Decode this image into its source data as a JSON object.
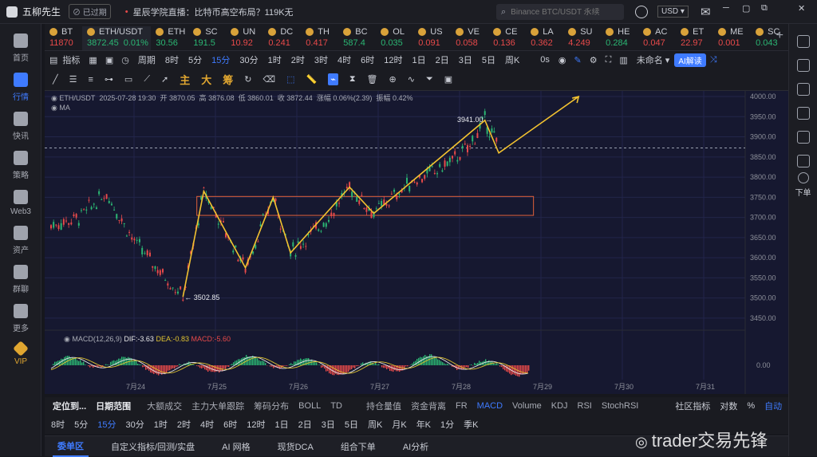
{
  "app": {
    "name": "五柳先生",
    "status": "已过期"
  },
  "news": {
    "headline": "星辰学院直播：比特币高空布局？119K无..."
  },
  "search": {
    "placeholder": "Binance BTC/USDT 永续"
  },
  "currency": "USD",
  "sidebar": [
    {
      "label": "首页"
    },
    {
      "label": "行情",
      "active": true
    },
    {
      "label": "快讯"
    },
    {
      "label": "策略"
    },
    {
      "label": "Web3"
    },
    {
      "label": "资产"
    },
    {
      "label": "群聊"
    },
    {
      "label": "更多"
    },
    {
      "label": "VIP"
    }
  ],
  "tickers": [
    {
      "sym": "BT",
      "price": "11870",
      "color": "#e84a4a"
    },
    {
      "sym": "ETH/USDT",
      "price": "3872.45",
      "change": "0.01%",
      "color": "#2bb673",
      "active": true
    },
    {
      "sym": "ETH",
      "price": "30.56",
      "color": "#2bb673"
    },
    {
      "sym": "SC",
      "price": "191.5",
      "color": "#2bb673"
    },
    {
      "sym": "UN",
      "price": "10.92",
      "color": "#e84a4a"
    },
    {
      "sym": "DC",
      "price": "0.241",
      "color": "#e84a4a"
    },
    {
      "sym": "TH",
      "price": "0.417",
      "color": "#e84a4a"
    },
    {
      "sym": "BC",
      "price": "587.4",
      "color": "#2bb673"
    },
    {
      "sym": "OL",
      "price": "0.035",
      "color": "#2bb673"
    },
    {
      "sym": "US",
      "price": "0.091",
      "color": "#e84a4a"
    },
    {
      "sym": "VE",
      "price": "0.058",
      "color": "#e84a4a"
    },
    {
      "sym": "CE",
      "price": "0.136",
      "color": "#e84a4a"
    },
    {
      "sym": "LA",
      "price": "0.362",
      "color": "#e84a4a"
    },
    {
      "sym": "SU",
      "price": "4.249",
      "color": "#e84a4a"
    },
    {
      "sym": "HE",
      "price": "0.284",
      "color": "#2bb673"
    },
    {
      "sym": "AC",
      "price": "0.047",
      "color": "#e84a4a"
    },
    {
      "sym": "ET",
      "price": "22.97",
      "color": "#e84a4a"
    },
    {
      "sym": "ME",
      "price": "0.001",
      "color": "#e84a4a"
    },
    {
      "sym": "SC",
      "price": "0.043",
      "color": "#2bb673"
    }
  ],
  "toolbar1": {
    "indicators": "指标",
    "period": "周期",
    "intervals": [
      "8时",
      "5分",
      "15分",
      "30分",
      "1时",
      "2时",
      "3时",
      "4时",
      "6时",
      "12时",
      "1日",
      "2日",
      "3日",
      "5日",
      "周K"
    ],
    "active_interval": "15分",
    "countdown": "0s",
    "layout_name": "未命名",
    "ai_button": "AI解读"
  },
  "draw_tools": {
    "labels": [
      "主",
      "大",
      "筹"
    ]
  },
  "chart_header": {
    "symbol": "ETH/USDT",
    "datetime": "2025-07-28 19:30",
    "open_label": "开",
    "open": "3870.05",
    "high_label": "高",
    "high": "3876.08",
    "low_label": "低",
    "low": "3860.01",
    "close_label": "收",
    "close": "3872.44",
    "change_label": "涨幅",
    "change": "0.06%(2.39)",
    "amp_label": "振幅",
    "amp": "0.42%",
    "ma": "MA"
  },
  "chart_data": {
    "type": "line",
    "yticks": [
      "4000.00",
      "3950.00",
      "3900.00",
      "3850.00",
      "3800.00",
      "3750.00",
      "3700.00",
      "3650.00",
      "3600.00",
      "3550.00",
      "3500.00",
      "3450.00"
    ],
    "xticks": [
      "7月24",
      "7月25",
      "7月26",
      "7月27",
      "7月28",
      "7月29",
      "7月30",
      "7月31"
    ],
    "ylim": [
      3420,
      4010
    ],
    "price_path": [
      {
        "x": 0.0,
        "y": 3680
      },
      {
        "x": 0.04,
        "y": 3700
      },
      {
        "x": 0.08,
        "y": 3760
      },
      {
        "x": 0.12,
        "y": 3640
      },
      {
        "x": 0.15,
        "y": 3580
      },
      {
        "x": 0.19,
        "y": 3502.85
      },
      {
        "x": 0.22,
        "y": 3765
      },
      {
        "x": 0.28,
        "y": 3575
      },
      {
        "x": 0.32,
        "y": 3750
      },
      {
        "x": 0.345,
        "y": 3612
      },
      {
        "x": 0.4,
        "y": 3700
      },
      {
        "x": 0.43,
        "y": 3775
      },
      {
        "x": 0.465,
        "y": 3710
      },
      {
        "x": 0.52,
        "y": 3790
      },
      {
        "x": 0.56,
        "y": 3820
      },
      {
        "x": 0.6,
        "y": 3870
      },
      {
        "x": 0.625,
        "y": 3941
      },
      {
        "x": 0.645,
        "y": 3875
      }
    ],
    "annotations": {
      "high": "3941.00",
      "low": "3502.85"
    },
    "zone": [
      3705,
      3752
    ],
    "dashed_level": 3872.44,
    "macd": {
      "label": "MACD(12,26,9)",
      "dif": "DIF:-3.63",
      "dea": "DEA:-0.83",
      "macd": "MACD:-5.60",
      "zero": "0.00"
    }
  },
  "bottombar1": {
    "locate": "定位到...",
    "date_range": "日期范围",
    "items": [
      "大额成交",
      "主力大单跟踪",
      "筹码分布",
      "BOLL",
      "TD",
      "持仓量值",
      "资金背离",
      "FR",
      "MACD",
      "Volume",
      "KDJ",
      "RSI",
      "StochRSI"
    ],
    "active": "MACD",
    "community": "社区指标",
    "log": "对数",
    "pct": "%",
    "auto": "自动"
  },
  "bottombar2": {
    "intervals": [
      "8时",
      "5分",
      "15分",
      "30分",
      "1时",
      "2时",
      "4时",
      "6时",
      "12时",
      "1日",
      "2日",
      "3日",
      "5日",
      "周K",
      "月K",
      "年K",
      "1分",
      "季K"
    ],
    "active": "15分"
  },
  "bottomtabs": [
    "委单区",
    "自定义指标/回测/实盘",
    "AI 网格",
    "现货DCA",
    "组合下单",
    "AI分析"
  ],
  "watermark": "trader交易先锋",
  "rightbar": {
    "label": "下单"
  }
}
